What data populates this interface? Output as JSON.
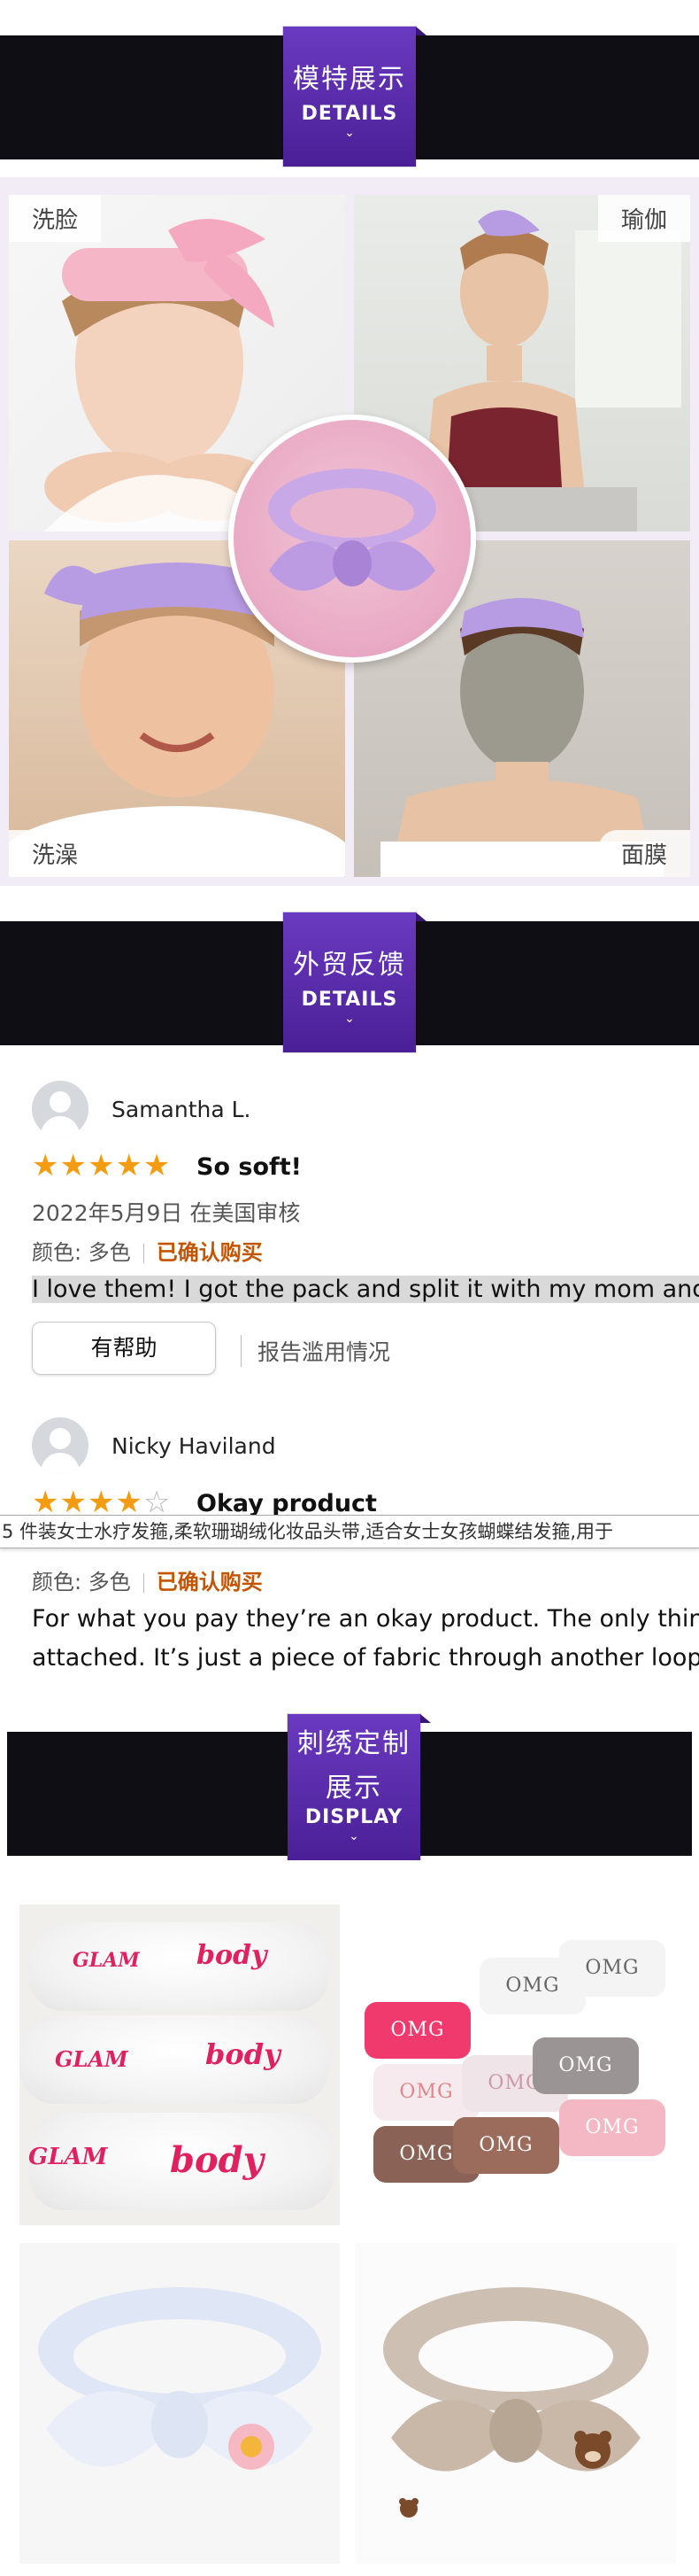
{
  "sections": {
    "models": {
      "cn": "模特展示",
      "en": "DETAILS",
      "chevron": "⌄"
    },
    "feedback": {
      "cn": "外贸反馈",
      "en": "DETAILS",
      "chevron": "⌄"
    },
    "custom": {
      "cn_line1": "刺绣定制",
      "cn_line2": "展示",
      "en": "DISPLAY",
      "chevron": "⌄"
    }
  },
  "collage": {
    "labels": {
      "top_left": "洗脸",
      "top_right": "瑜伽",
      "bottom_left": "洗澡",
      "bottom_right": "面膜"
    }
  },
  "reviews": [
    {
      "name": "Samantha L.",
      "stars": "★★★★★",
      "stars_off": "",
      "title": "So soft!",
      "date": "2022年5月9日 在美国审核",
      "color": "颜色: 多色",
      "verified": "已确认购买",
      "body": "I love them! I got the pack and split it with my mom and w",
      "helpful": "有帮助",
      "report": "报告滥用情况"
    },
    {
      "name": "Nicky Haviland",
      "stars": "★★★★",
      "stars_off": "☆",
      "title": "Okay product",
      "color": "颜色: 多色",
      "verified": "已确认购买",
      "body_line1": "For what you pay they’re an okay product. The only thing",
      "body_line2": "attached. It’s just a piece of fabric through another loope"
    }
  ],
  "caption_strip": "5 件装女士水疗发箍,柔软珊瑚绒化妆品头带,适合女士女孩蝴蝶结发箍,用于",
  "custom_grid": {
    "glam_word": "GLAM",
    "body_word": "body",
    "omg_word": "OMG"
  }
}
